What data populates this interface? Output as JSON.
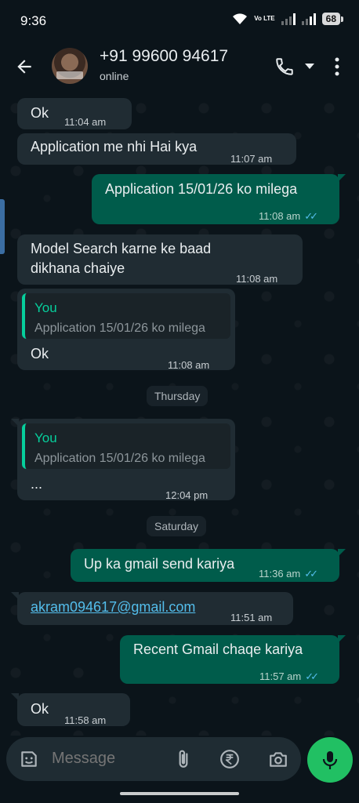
{
  "status": {
    "time": "9:36",
    "battery": "68",
    "network_label": "Vo LTE"
  },
  "header": {
    "contact_name": "+91 99600 94617",
    "contact_status": "online"
  },
  "messages": [
    {
      "dir": "in",
      "text": "Ok",
      "time": "11:04 am"
    },
    {
      "dir": "in",
      "text": "Application me nhi Hai kya",
      "time": "11:07 am"
    },
    {
      "dir": "out",
      "text": "Application 15/01/26 ko milega",
      "time": "11:08 am",
      "read": true
    },
    {
      "dir": "in",
      "text": "Model Search karne ke baad dikhana chaiye",
      "time": "11:08 am"
    },
    {
      "dir": "in",
      "quote_author": "You",
      "quote_text": "Application 15/01/26 ko milega",
      "text": "Ok",
      "time": "11:08 am"
    },
    {
      "dir": "in",
      "quote_author": "You",
      "quote_text": "Application 15/01/26 ko milega",
      "text": "...",
      "time": "12:04 pm"
    },
    {
      "dir": "out",
      "text": "Up ka gmail send kariya",
      "time": "11:36 am",
      "read": true
    },
    {
      "dir": "in",
      "text": "akram094617@gmail.com",
      "time": "11:51 am",
      "is_link": true
    },
    {
      "dir": "out",
      "text": "Recent Gmail chaqe kariya",
      "time": "11:57 am",
      "read": true
    },
    {
      "dir": "in",
      "text": "Ok",
      "time": "11:58 am"
    }
  ],
  "dates": {
    "d1": "Thursday",
    "d2": "Saturday"
  },
  "composer": {
    "placeholder": "Message"
  },
  "colors": {
    "incoming": "#202c33",
    "outgoing": "#005c4b",
    "accent": "#21c063",
    "read_ticks": "#53bdeb"
  },
  "icons": [
    "back-arrow-icon",
    "phone-icon",
    "more-vert-icon",
    "sticker-icon",
    "attach-icon",
    "rupee-icon",
    "camera-icon",
    "mic-icon"
  ]
}
